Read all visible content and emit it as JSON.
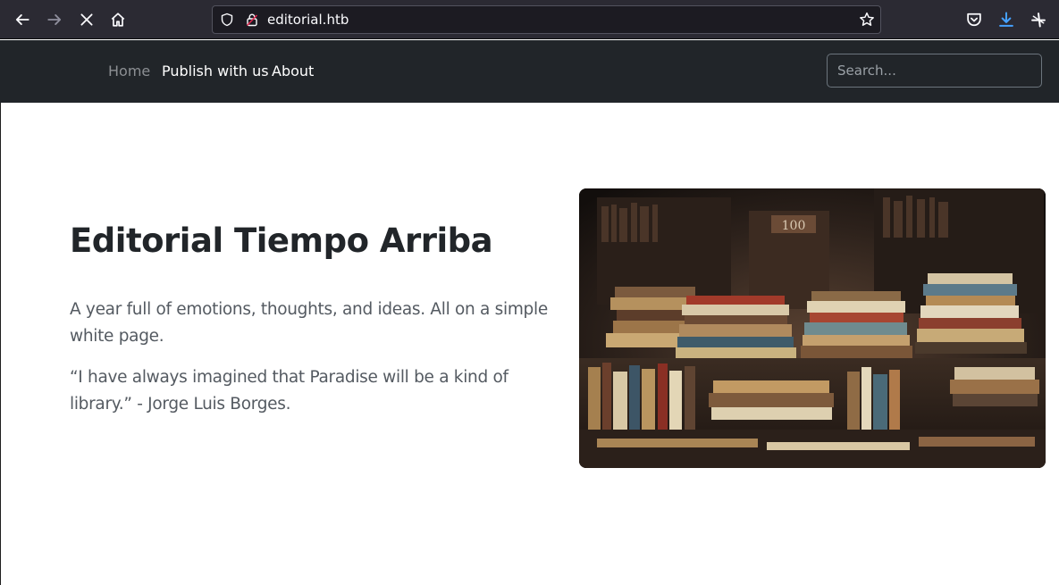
{
  "browser": {
    "url": "editorial.htb",
    "icons": [
      "back-icon",
      "forward-icon",
      "stop-loading-icon",
      "home-icon",
      "shield-icon",
      "lock-icon",
      "bookmark-star-icon",
      "pocket-icon",
      "download-icon",
      "extension-icon"
    ]
  },
  "navbar": {
    "links": [
      {
        "label": "Home",
        "state": "muted"
      },
      {
        "label": "Publish with us",
        "state": "active"
      },
      {
        "label": "About",
        "state": "active"
      }
    ],
    "search": {
      "placeholder": "Search...",
      "value": ""
    }
  },
  "hero": {
    "title": "Editorial Tiempo Arriba",
    "paragraph1": "A year full of emotions, thoughts, and ideas. All on a simple white page.",
    "paragraph2": "“I have always imagined that Paradise will be a kind of library.” - Jorge Luis Borges.",
    "image_description": "stacks of old books in a bookshop"
  },
  "colors": {
    "chrome_bg": "#2b2a33",
    "urlbar_bg": "#1c1b22",
    "navbar_bg": "#212529",
    "title_color": "#212529",
    "text_color": "#545a61",
    "download_accent": "#45a1ff"
  }
}
